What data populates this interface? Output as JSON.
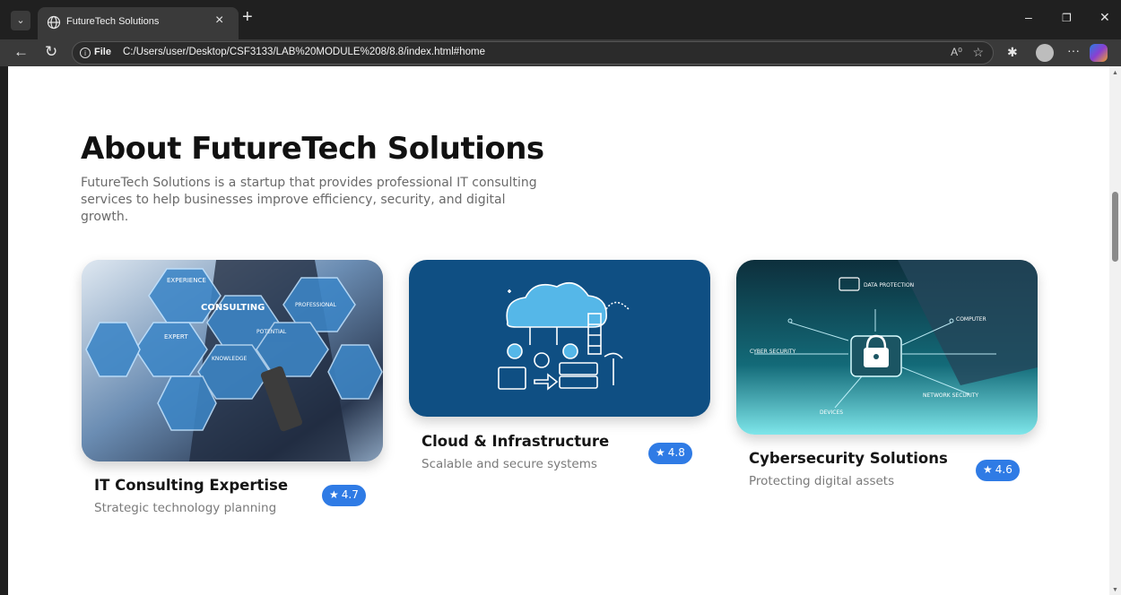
{
  "browser": {
    "tab_title": "FutureTech Solutions",
    "url_scheme_label": "File",
    "url": "C:/Users/user/Desktop/CSF3133/LAB%20MODULE%208/8.8/index.html#home"
  },
  "about": {
    "heading": "About FutureTech Solutions",
    "description": "FutureTech Solutions is a startup that provides professional IT consulting services to help businesses improve efficiency, security, and digital growth."
  },
  "cards": [
    {
      "title": "IT Consulting Expertise",
      "subtitle": "Strategic technology planning",
      "rating": "4.7",
      "image_labels": [
        "EXPERIENCE",
        "CONSULTING",
        "PROFESSIONAL",
        "EXPERT",
        "POTENTIAL",
        "KNOWLEDGE"
      ]
    },
    {
      "title": "Cloud & Infrastructure",
      "subtitle": "Scalable and secure systems",
      "rating": "4.8"
    },
    {
      "title": "Cybersecurity Solutions",
      "subtitle": "Protecting digital assets",
      "rating": "4.6",
      "image_labels": [
        "DATA PROTECTION",
        "COMPUTER",
        "CYBER SECURITY",
        "NETWORK SECURITY",
        "DEVICES"
      ]
    }
  ],
  "colors": {
    "rating_badge": "#2f7be5",
    "cloud_card_bg": "#0f4f83"
  },
  "icons": [
    "tab-list-icon",
    "globe-icon",
    "close-icon",
    "plus-icon",
    "minimize-icon",
    "restore-icon",
    "back-icon",
    "refresh-icon",
    "info-icon",
    "read-aloud-icon",
    "favorite-star-icon",
    "favorites-icon",
    "profile-icon",
    "more-icon",
    "copilot-icon",
    "star-icon"
  ]
}
